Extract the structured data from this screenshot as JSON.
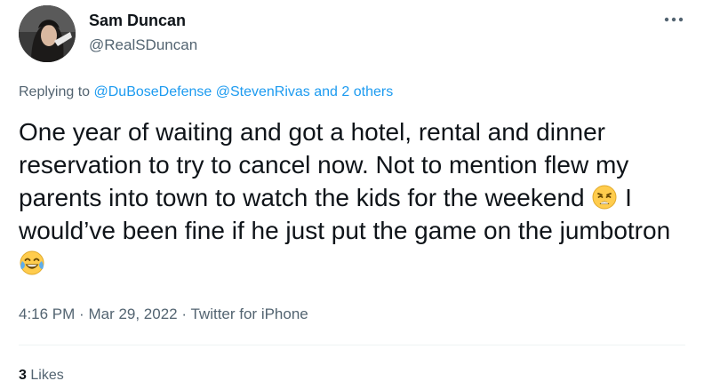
{
  "author": {
    "name": "Sam Duncan",
    "handle": "@RealSDuncan"
  },
  "more_icon": "more-horizontal-icon",
  "reply": {
    "prefix": "Replying to",
    "mentions": [
      "@DuBoseDefense",
      "@StevenRivas"
    ],
    "others": "and 2 others"
  },
  "tweet": {
    "text_part1": "One year of waiting and got a hotel, rental and dinner reservation to try to cancel now. Not to mention flew my parents into town to watch the kids for the weekend",
    "emoji1": "weary-face-emoji",
    "text_part2": "I would’ve been fine if he just put the game on the jumbotron",
    "emoji2": "face-with-tears-of-joy-emoji"
  },
  "meta": {
    "time": "4:16 PM",
    "separator": "·",
    "date": "Mar 29, 2022",
    "source": "Twitter for iPhone"
  },
  "likes": {
    "count": "3",
    "label": "Likes"
  },
  "colors": {
    "text": "#0f1419",
    "secondary": "#536471",
    "link": "#1d9bf0",
    "divider": "#eff3f4"
  }
}
